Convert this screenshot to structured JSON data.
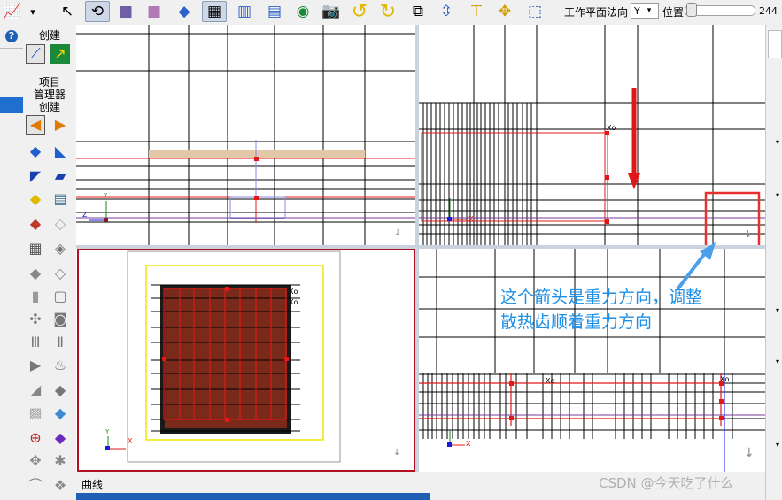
{
  "toolbar": {
    "work_plane_label": "工作平面法向",
    "axis_value": "Y",
    "position_label": "位置",
    "position_value": "244"
  },
  "palette": {
    "create_top": "创建",
    "project_manager_line1": "项目",
    "project_manager_line2": "管理器",
    "project_manager_line3": "创建"
  },
  "viewports": {
    "triad_axis_y": "Y",
    "triad_axis_z": "Z",
    "triad_axis_x": "X",
    "coord_tag_top_right": "Xo",
    "coord_tag_bottom_left_1": "Xo",
    "coord_tag_bottom_left_2": "Xo",
    "coord_tag_bottom_right_1": "Xo",
    "coord_tag_bottom_right_2": "Xo"
  },
  "annotation": {
    "line1": "这个箭头是重力方向，调整",
    "line2": "散热齿顺着重力方向"
  },
  "bottom": {
    "curve_label": "曲线"
  },
  "watermark": "CSDN @今天吃了什么",
  "colors": {
    "grid": "#000000",
    "model_red": "#e01818",
    "highlight_red": "#e83030",
    "annotation_blue": "#1e8fe6",
    "plane_yellow": "#f2e600",
    "view_border_active": "#b01020"
  }
}
